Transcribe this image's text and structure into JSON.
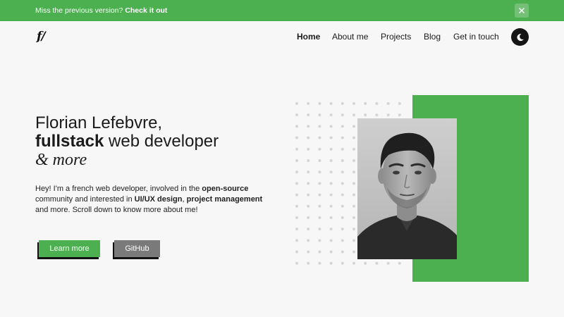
{
  "announcement": {
    "text": "Miss the previous version?",
    "link": "Check it out",
    "close_label": "×"
  },
  "brand": {
    "logo": "f/"
  },
  "nav": {
    "items": [
      {
        "label": "Home",
        "active": true
      },
      {
        "label": "About me",
        "active": false
      },
      {
        "label": "Projects",
        "active": false
      },
      {
        "label": "Blog",
        "active": false
      },
      {
        "label": "Get in touch",
        "active": false
      }
    ],
    "theme_icon": "moon-icon"
  },
  "hero": {
    "name": "Florian Lefebvre,",
    "role_bold": "fullstack",
    "role_rest": " web developer",
    "more": "& more",
    "intro": {
      "p1": "Hey! I'm a french web developer, involved in the ",
      "b1": "open-source",
      "p2": " community and interested in ",
      "b2": "UI/UX design",
      "p3": ", ",
      "b3": "project management",
      "p4": " and more. Scroll down to know more about me!"
    },
    "buttons": {
      "primary": "Learn more",
      "secondary": "GitHub"
    }
  },
  "colors": {
    "accent": "#4caf50",
    "dark": "#151515",
    "background": "#f6f7f6",
    "secondary_button": "#7a7a7a"
  }
}
